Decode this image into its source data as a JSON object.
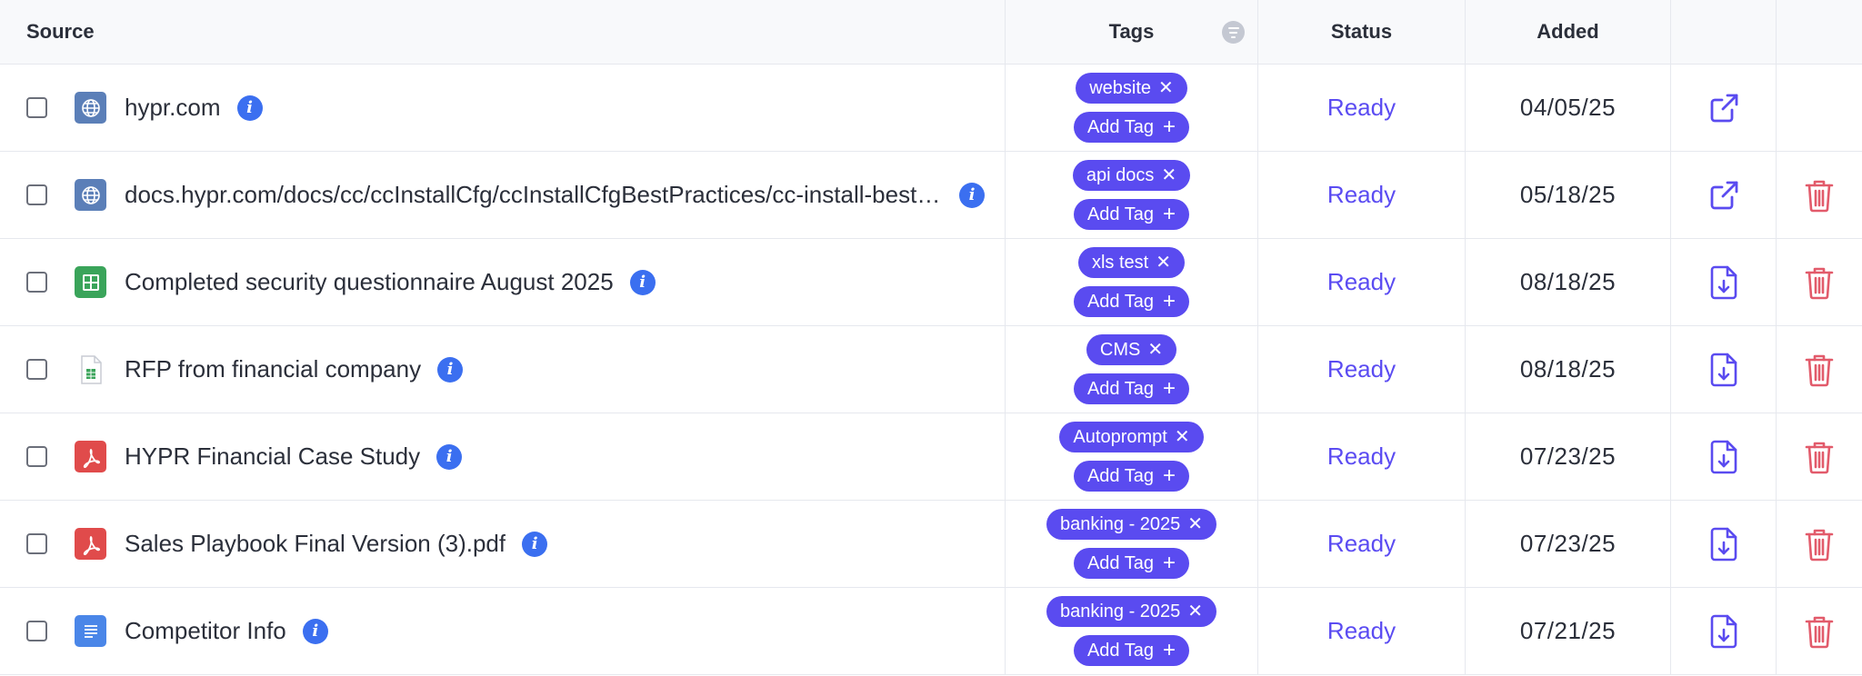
{
  "header": {
    "source": "Source",
    "tags": "Tags",
    "status": "Status",
    "added": "Added"
  },
  "add_tag_label": "Add Tag",
  "status_label": "Ready",
  "colors": {
    "accent": "#5a4bf0",
    "info": "#3b6ff0",
    "delete": "#e25b6b"
  },
  "rows": [
    {
      "icon": "globe-icon",
      "title": "hypr.com",
      "tag": "website",
      "status": "Ready",
      "added": "04/05/25",
      "action": "external-link-icon",
      "deletable": false
    },
    {
      "icon": "globe-icon",
      "title": "docs.hypr.com/docs/cc/ccInstallCfg/ccInstallCfgBestPractices/cc-install-best-practices",
      "tag": "api docs",
      "status": "Ready",
      "added": "05/18/25",
      "action": "external-link-icon",
      "deletable": true
    },
    {
      "icon": "spreadsheet-icon",
      "title": "Completed security questionnaire August 2025",
      "tag": "xls test",
      "status": "Ready",
      "added": "08/18/25",
      "action": "file-download-icon",
      "deletable": true
    },
    {
      "icon": "csv-file-icon",
      "title": "RFP from financial company",
      "tag": "CMS",
      "status": "Ready",
      "added": "08/18/25",
      "action": "file-download-icon",
      "deletable": true
    },
    {
      "icon": "pdf-icon",
      "title": "HYPR Financial Case Study",
      "tag": "Autoprompt",
      "status": "Ready",
      "added": "07/23/25",
      "action": "file-download-icon",
      "deletable": true
    },
    {
      "icon": "pdf-icon",
      "title": "Sales Playbook Final Version (3).pdf",
      "tag": "banking - 2025",
      "status": "Ready",
      "added": "07/23/25",
      "action": "file-download-icon",
      "deletable": true
    },
    {
      "icon": "document-icon",
      "title": "Competitor Info",
      "tag": "banking - 2025",
      "status": "Ready",
      "added": "07/21/25",
      "action": "file-download-icon",
      "deletable": true
    }
  ]
}
